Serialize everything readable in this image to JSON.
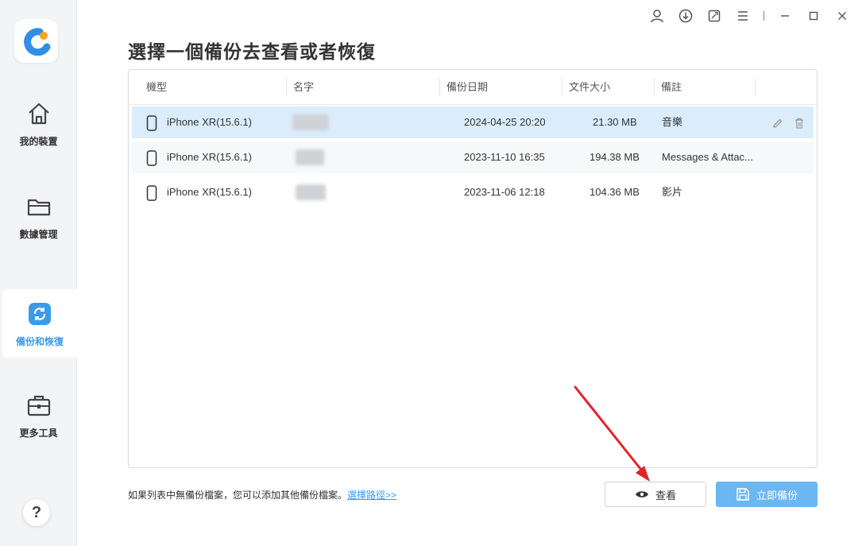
{
  "window": {
    "icons": [
      "user-icon",
      "download-icon",
      "feedback-icon",
      "menu-icon",
      "minimize-icon",
      "maximize-icon",
      "close-icon"
    ]
  },
  "sidebar": {
    "items": [
      {
        "label": "我的裝置",
        "icon": "home-icon"
      },
      {
        "label": "數據管理",
        "icon": "folder-icon"
      },
      {
        "label": "備份和恢復",
        "icon": "sync-icon",
        "active": true
      },
      {
        "label": "更多工具",
        "icon": "toolbox-icon"
      }
    ],
    "help": "?"
  },
  "main": {
    "title": "選擇一個備份去查看或者恢復",
    "columns": [
      "機型",
      "名字",
      "備份日期",
      "文件大小",
      "備註"
    ],
    "rows": [
      {
        "model": "iPhone XR(15.6.1)",
        "name": "",
        "date": "2024-04-25 20:20",
        "size": "21.30 MB",
        "note": "音樂"
      },
      {
        "model": "iPhone XR(15.6.1)",
        "name": "",
        "date": "2023-11-10 16:35",
        "size": "194.38 MB",
        "note": "Messages & Attac..."
      },
      {
        "model": "iPhone XR(15.6.1)",
        "name": "",
        "date": "2023-11-06 12:18",
        "size": "104.36 MB",
        "note": "影片"
      }
    ]
  },
  "footer": {
    "hint": "如果列表中無備份檔案，您可以添加其他備份檔案。",
    "link": "選擇路徑>>",
    "view_label": "查看",
    "backup_label": "立即備份"
  },
  "colors": {
    "accent": "#3a9be8",
    "selected_row": "#dbedfb",
    "backup_button": "#6cb6f1",
    "arrow": "#e0242c"
  }
}
